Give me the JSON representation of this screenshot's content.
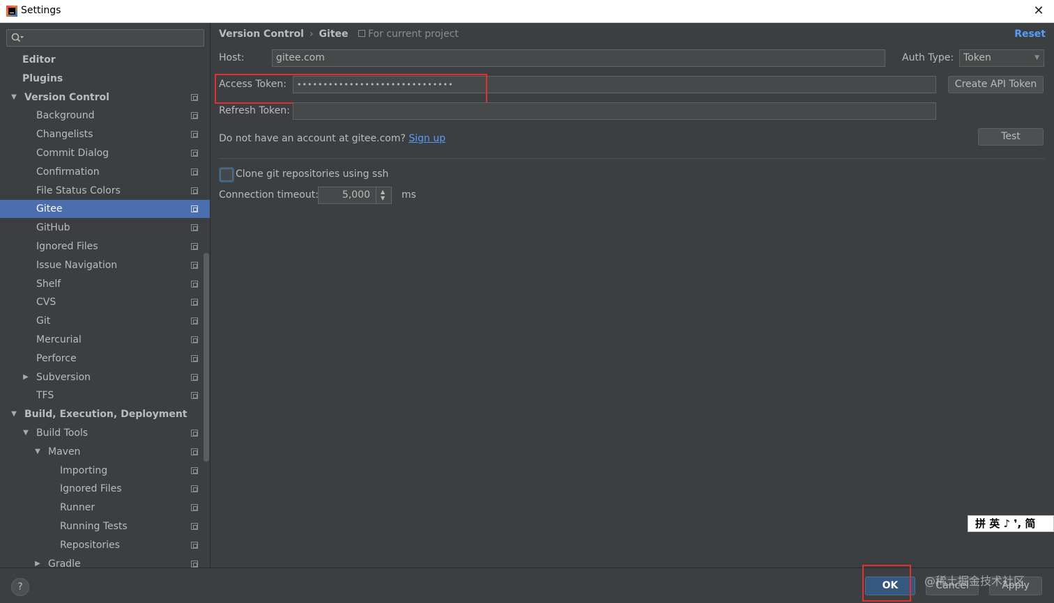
{
  "window": {
    "title": "Settings"
  },
  "search": {
    "placeholder": ""
  },
  "sidebar": {
    "items": [
      {
        "label": "Editor",
        "bold": true,
        "level": 0,
        "arrow": "",
        "project": false
      },
      {
        "label": "Plugins",
        "bold": true,
        "level": 0,
        "arrow": "",
        "project": false
      },
      {
        "label": "Version Control",
        "bold": true,
        "level": 0,
        "arrow": "down",
        "project": true
      },
      {
        "label": "Background",
        "level": 1,
        "project": true
      },
      {
        "label": "Changelists",
        "level": 1,
        "project": true
      },
      {
        "label": "Commit Dialog",
        "level": 1,
        "project": true
      },
      {
        "label": "Confirmation",
        "level": 1,
        "project": true
      },
      {
        "label": "File Status Colors",
        "level": 1,
        "project": true
      },
      {
        "label": "Gitee",
        "level": 1,
        "project": true,
        "selected": true
      },
      {
        "label": "GitHub",
        "level": 1,
        "project": true
      },
      {
        "label": "Ignored Files",
        "level": 1,
        "project": true
      },
      {
        "label": "Issue Navigation",
        "level": 1,
        "project": true
      },
      {
        "label": "Shelf",
        "level": 1,
        "project": true
      },
      {
        "label": "CVS",
        "level": 1,
        "project": true
      },
      {
        "label": "Git",
        "level": 1,
        "project": true
      },
      {
        "label": "Mercurial",
        "level": 1,
        "project": true
      },
      {
        "label": "Perforce",
        "level": 1,
        "project": true
      },
      {
        "label": "Subversion",
        "level": 1,
        "arrow": "right",
        "project": true
      },
      {
        "label": "TFS",
        "level": 1,
        "project": true
      },
      {
        "label": "Build, Execution, Deployment",
        "bold": true,
        "level": 0,
        "arrow": "down",
        "project": false
      },
      {
        "label": "Build Tools",
        "level": 1,
        "arrow": "down",
        "project": true
      },
      {
        "label": "Maven",
        "level": 2,
        "arrow": "down",
        "project": true
      },
      {
        "label": "Importing",
        "level": 3,
        "project": true
      },
      {
        "label": "Ignored Files",
        "level": 3,
        "project": true
      },
      {
        "label": "Runner",
        "level": 3,
        "project": true
      },
      {
        "label": "Running Tests",
        "level": 3,
        "project": true
      },
      {
        "label": "Repositories",
        "level": 3,
        "project": true
      },
      {
        "label": "Gradle",
        "level": 2,
        "arrow": "right",
        "project": true
      }
    ]
  },
  "main": {
    "breadcrumb": {
      "parent": "Version Control",
      "separator": "›",
      "current": "Gitee"
    },
    "for_project": "For current project",
    "reset_label": "Reset",
    "host": {
      "label": "Host:",
      "value": "gitee.com"
    },
    "auth_type": {
      "label": "Auth Type:",
      "value": "Token"
    },
    "access_token": {
      "label": "Access Token:",
      "value": "••••••••••••••••••••••••••••••"
    },
    "create_token_label": "Create API Token",
    "refresh_token": {
      "label": "Refresh Token:",
      "value": ""
    },
    "account_prompt": "Do not have an account at gitee.com?",
    "signup_label": "Sign up",
    "test_label": "Test",
    "clone_ssh": {
      "label": "Clone git repositories using ssh",
      "checked": false
    },
    "timeout": {
      "label": "Connection timeout:",
      "value": "5,000",
      "unit": "ms"
    }
  },
  "footer": {
    "help_label": "?",
    "ok_label": "OK",
    "cancel_label": "Cancel",
    "apply_label": "Apply"
  },
  "ime_bar": {
    "text": "拼 英 ♪ ❜, 简"
  },
  "watermark": "@稀土掘金技术社区",
  "colors": {
    "background": "#3c3f41",
    "selection": "#4b6eaf",
    "link": "#589df6",
    "highlight": "#e03030",
    "primary_button": "#365880"
  }
}
